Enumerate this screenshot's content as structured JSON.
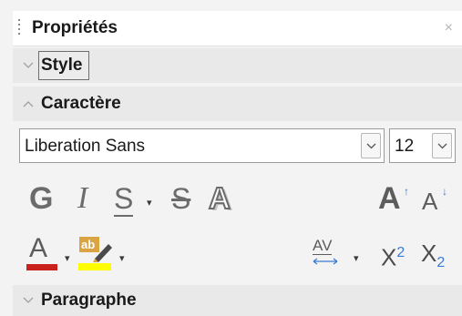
{
  "panel": {
    "title": "Propriétés",
    "close_icon": "×"
  },
  "sections": {
    "style": {
      "label": "Style",
      "expanded": false
    },
    "character": {
      "label": "Caractère",
      "expanded": true
    },
    "paragraph": {
      "label": "Paragraphe",
      "expanded": false
    }
  },
  "character": {
    "font_name": "Liberation Sans",
    "font_size": "12",
    "bold_label": "G",
    "italic_label": "I",
    "underline_label": "S",
    "strikethrough_label": "S",
    "shadow_label": "A",
    "grow_label": "A",
    "shrink_label": "A",
    "font_color_label": "A",
    "highlight_label": "ab",
    "spacing_label": "AV",
    "superscript_label": "X",
    "superscript_mark": "2",
    "subscript_label": "X",
    "subscript_mark": "2",
    "font_color": "#c9211e",
    "highlight_color": "#ffff00"
  }
}
